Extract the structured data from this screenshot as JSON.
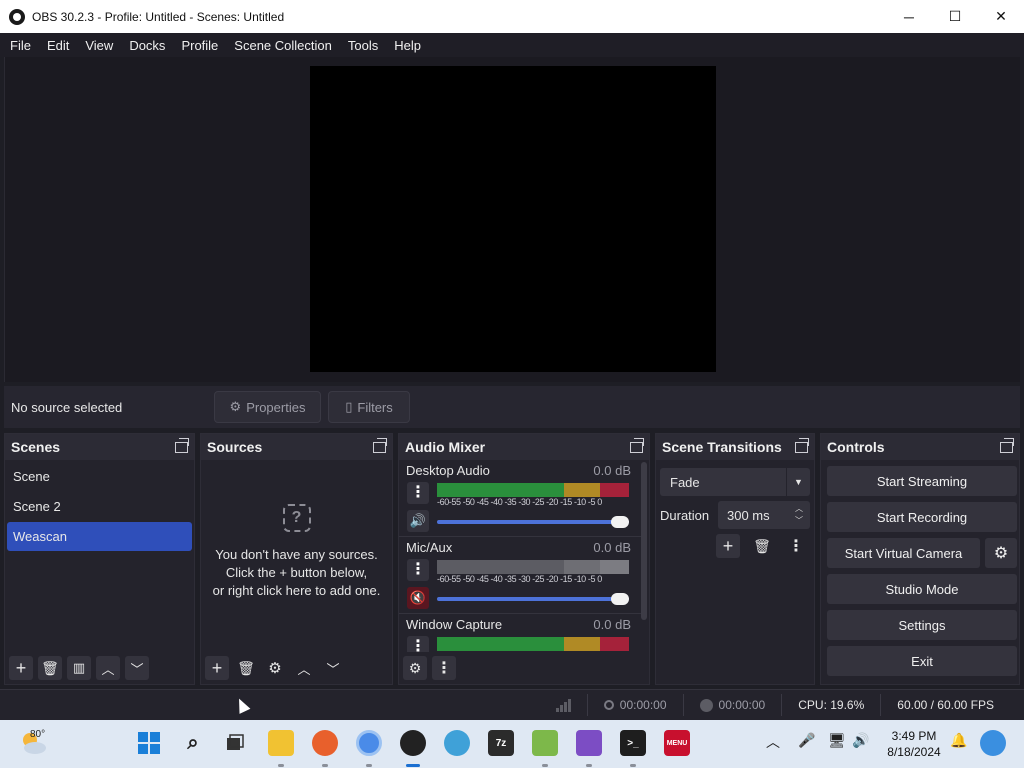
{
  "window": {
    "title": "OBS 30.2.3 - Profile: Untitled - Scenes: Untitled",
    "minimize": "─",
    "maximize": "☐",
    "close": "✕"
  },
  "menu": [
    "File",
    "Edit",
    "View",
    "Docks",
    "Profile",
    "Scene Collection",
    "Tools",
    "Help"
  ],
  "source_bar": {
    "status": "No source selected",
    "properties": "Properties",
    "filters": "Filters"
  },
  "scenes": {
    "title": "Scenes",
    "items": [
      "Scene",
      "Scene 2",
      "Weascan"
    ],
    "selected": "Weascan"
  },
  "sources": {
    "title": "Sources",
    "empty_icon": "?",
    "empty_lines": [
      "You don't have any sources.",
      "Click the + button below,",
      "or right click here to add one."
    ]
  },
  "mixer": {
    "title": "Audio Mixer",
    "ticks": "-60-55 -50 -45 -40 -35 -30 -25 -20 -15 -10 -5  0",
    "channels": [
      {
        "name": "Desktop Audio",
        "db": "0.0 dB",
        "muted": false,
        "volume": 1.0
      },
      {
        "name": "Mic/Aux",
        "db": "0.0 dB",
        "muted": true,
        "volume": 1.0
      },
      {
        "name": "Window Capture",
        "db": "0.0 dB",
        "muted": false,
        "volume": 1.0
      }
    ]
  },
  "transitions": {
    "title": "Scene Transitions",
    "selected": "Fade",
    "duration_label": "Duration",
    "duration_value": "300 ms"
  },
  "controls": {
    "title": "Controls",
    "start_streaming": "Start Streaming",
    "start_recording": "Start Recording",
    "start_virtual_camera": "Start Virtual Camera",
    "studio_mode": "Studio Mode",
    "settings": "Settings",
    "exit": "Exit"
  },
  "status": {
    "stream_time": "00:00:00",
    "record_time": "00:00:00",
    "cpu": "CPU: 19.6%",
    "fps": "60.00 / 60.00 FPS"
  },
  "taskbar": {
    "temperature": "80°",
    "time": "3:49 PM",
    "date": "8/18/2024",
    "apps": [
      "start-icon",
      "search-icon",
      "task-view-icon",
      "file-explorer-icon",
      "firefox-icon",
      "chrome-icon",
      "obs-icon",
      "app-icon",
      "7zip-icon",
      "notepad-plus-icon",
      "visual-studio-icon",
      "terminal-icon",
      "menu-app-icon"
    ]
  },
  "colors": {
    "selection": "#2f4fba",
    "slider": "#4d72d9",
    "meter_green": "#2a8f3c",
    "meter_yellow": "#b08a25",
    "meter_red": "#a5223a"
  }
}
